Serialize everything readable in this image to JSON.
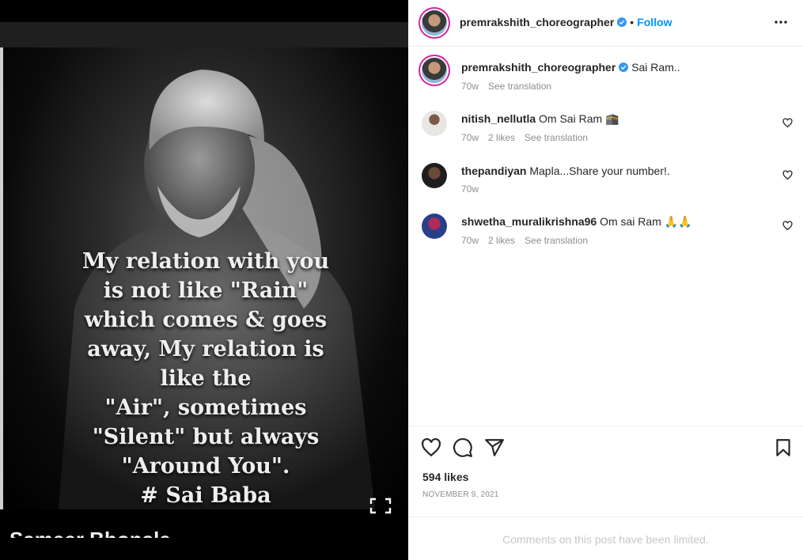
{
  "media": {
    "quote": "My relation with you\nis not like \"Rain\"\nwhich comes & goes\naway, My relation is\nlike the\n\"Air\", sometimes\n\"Silent\" but always\n\"Around You\".\n# Sai Baba",
    "bottom_caption": "Sameer Bhonsle"
  },
  "header": {
    "username": "premrakshith_choreographer",
    "separator": "•",
    "follow_label": "Follow",
    "more_icon": "more-horizontal-icon"
  },
  "comments": [
    {
      "username": "premrakshith_choreographer",
      "verified": true,
      "text": "Sai Ram..",
      "time": "70w",
      "likes": "",
      "translate": "See translation"
    },
    {
      "username": "nitish_nellutla",
      "verified": false,
      "text": "Om Sai Ram 🕋",
      "time": "70w",
      "likes": "2 likes",
      "translate": "See translation"
    },
    {
      "username": "thepandiyan",
      "verified": false,
      "text": "Mapla...Share your number!.",
      "time": "70w",
      "likes": "",
      "translate": ""
    },
    {
      "username": "shwetha_muralikrishna96",
      "verified": false,
      "text": "Om sai Ram 🙏🙏",
      "time": "70w",
      "likes": "2 likes",
      "translate": "See translation"
    }
  ],
  "actions": {
    "likes_count": "594 likes",
    "date": "November 9, 2021"
  },
  "footer": {
    "limited_text": "Comments on this post have been limited."
  },
  "colors": {
    "link": "#0095f6",
    "muted": "#8e8e8e",
    "verified": "#3897f0"
  }
}
